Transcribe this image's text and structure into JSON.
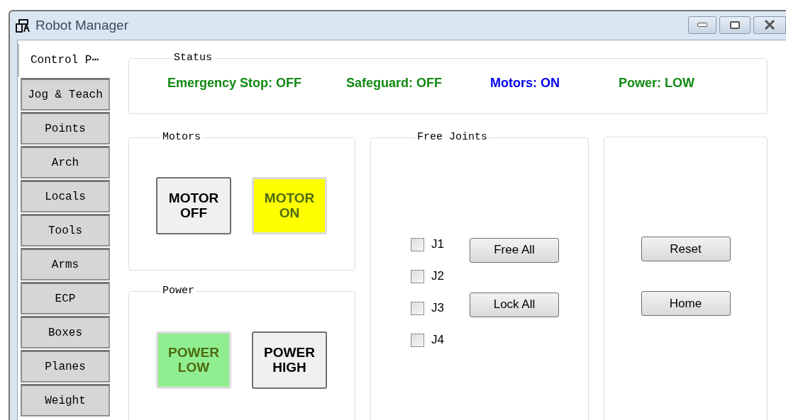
{
  "window": {
    "title": "Robot Manager"
  },
  "tabs": [
    {
      "label": "Control P⋯",
      "selected": true
    },
    {
      "label": "Jog & Teach",
      "selected": false
    },
    {
      "label": "Points",
      "selected": false
    },
    {
      "label": "Arch",
      "selected": false
    },
    {
      "label": "Locals",
      "selected": false
    },
    {
      "label": "Tools",
      "selected": false
    },
    {
      "label": "Arms",
      "selected": false
    },
    {
      "label": "ECP",
      "selected": false
    },
    {
      "label": "Boxes",
      "selected": false
    },
    {
      "label": "Planes",
      "selected": false
    },
    {
      "label": "Weight",
      "selected": false
    }
  ],
  "status": {
    "title": "Status",
    "items": [
      {
        "text": "Emergency Stop: OFF",
        "color": "#118811"
      },
      {
        "text": "Safeguard: OFF",
        "color": "#118811"
      },
      {
        "text": "Motors: ON",
        "color": "#0000ee"
      },
      {
        "text": "Power: LOW",
        "color": "#118811"
      }
    ]
  },
  "motors": {
    "title": "Motors",
    "buttons": [
      {
        "label": "MOTOR OFF",
        "selected": false,
        "color": "#f0f0f0"
      },
      {
        "label": "MOTOR ON",
        "selected": true,
        "color": "#ffff00"
      }
    ]
  },
  "power": {
    "title": "Power",
    "buttons": [
      {
        "label": "POWER LOW",
        "selected": true,
        "color": "#90ee90"
      },
      {
        "label": "POWER HIGH",
        "selected": false,
        "color": "#f0f0f0"
      }
    ]
  },
  "free_joints": {
    "title": "Free Joints",
    "joints": [
      {
        "label": "J1",
        "checked": false
      },
      {
        "label": "J2",
        "checked": false
      },
      {
        "label": "J3",
        "checked": false
      },
      {
        "label": "J4",
        "checked": false
      }
    ],
    "buttons": [
      "Free All",
      "Lock All"
    ]
  },
  "actions": {
    "buttons": [
      "Reset",
      "Home"
    ]
  }
}
